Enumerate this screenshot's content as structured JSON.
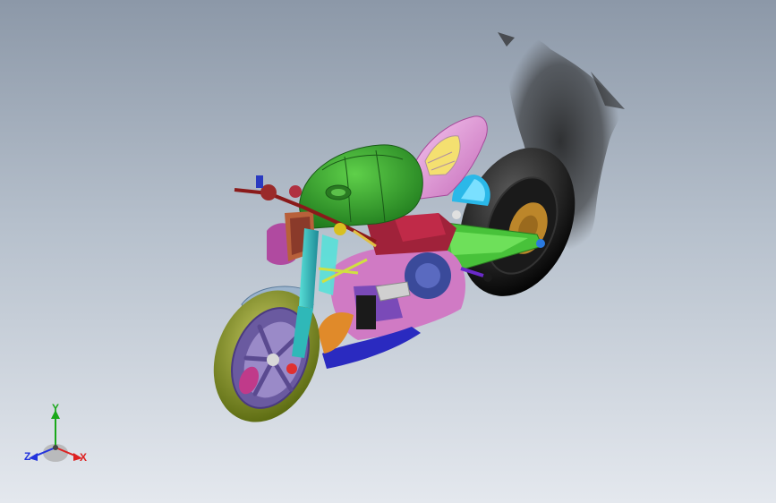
{
  "viewport": {
    "background_top": "#8c98a8",
    "background_bottom": "#e4e8ee"
  },
  "model": {
    "subject": "motorcycle-assembly",
    "colors": {
      "fuel_tank": "#2f9a2a",
      "rear_cowl": "#e39ad8",
      "front_tire": "#8a9a1c",
      "rear_tire": "#111111",
      "fork": "#2fb8b8",
      "swingarm": "#48c23a",
      "front_fender": "#9ab3cc",
      "headlight": "#b04aa0",
      "engine_cover": "#3a4a9a"
    }
  },
  "triad": {
    "y_label": "Y",
    "z_label": "Z",
    "x_label": "X",
    "y_color": "#1aa81a",
    "z_color": "#2233dd",
    "x_color": "#dd2222"
  }
}
